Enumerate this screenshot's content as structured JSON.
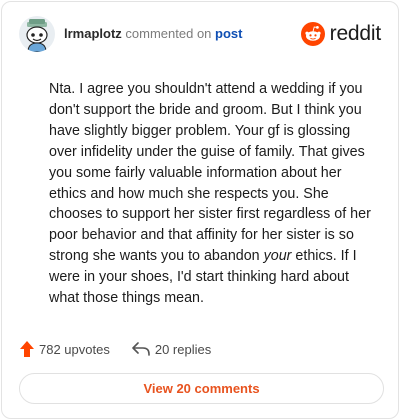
{
  "header": {
    "username": "lrmaplotz",
    "action": "commented on",
    "link_text": "post",
    "brand_name": "reddit",
    "avatar_icon": "snoo-avatar-icon",
    "brand_icon": "reddit-logo-icon"
  },
  "comment": {
    "text_before_emphasis": "Nta. I agree you shouldn't attend a wedding if you don't support the bride and groom. But I think you have slightly bigger problem. Your gf is glossing over infidelity under the guise of family. That gives you some fairly valuable information about her ethics and how much she respects you. She chooses to support her sister first regardless of her poor behavior and that affinity for her sister is so strong she wants you to abandon ",
    "emphasis": "your",
    "text_after_emphasis": " ethics. If I were in your shoes, I'd start thinking hard about what those things mean."
  },
  "stats": {
    "upvotes": "782 upvotes",
    "replies": "20 replies",
    "upvote_icon": "upvote-arrow-icon",
    "reply_icon": "reply-arrow-icon"
  },
  "footer": {
    "view_comments_label": "View 20 comments"
  },
  "colors": {
    "accent": "#e8531f",
    "brand": "#ff4500",
    "link": "#0f4fb4",
    "border": "#e3e3e3"
  }
}
